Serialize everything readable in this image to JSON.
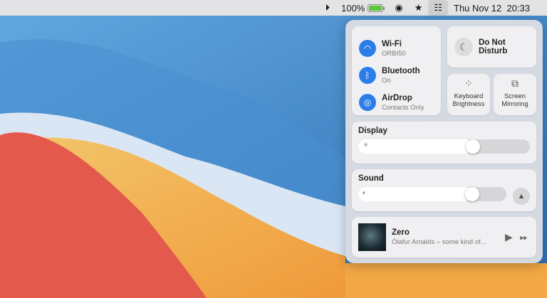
{
  "menubar": {
    "battery_percent": "100%",
    "battery_level": 1.0,
    "date": "Thu Nov 12",
    "time": "20:33"
  },
  "control_center": {
    "wifi": {
      "title": "Wi-Fi",
      "subtitle": "ORBI50"
    },
    "bluetooth": {
      "title": "Bluetooth",
      "subtitle": "On"
    },
    "airdrop": {
      "title": "AirDrop",
      "subtitle": "Contacts Only"
    },
    "dnd": {
      "title": "Do Not Disturb"
    },
    "keyboard": {
      "title": "Keyboard Brightness"
    },
    "mirroring": {
      "title": "Screen Mirroring"
    },
    "display": {
      "title": "Display",
      "level": 0.67
    },
    "sound": {
      "title": "Sound",
      "level": 0.77
    },
    "now_playing": {
      "title": "Zero",
      "subtitle": "Ólafur Arnalds – some kind of..."
    }
  },
  "colors": {
    "accent": "#2b7de9"
  }
}
